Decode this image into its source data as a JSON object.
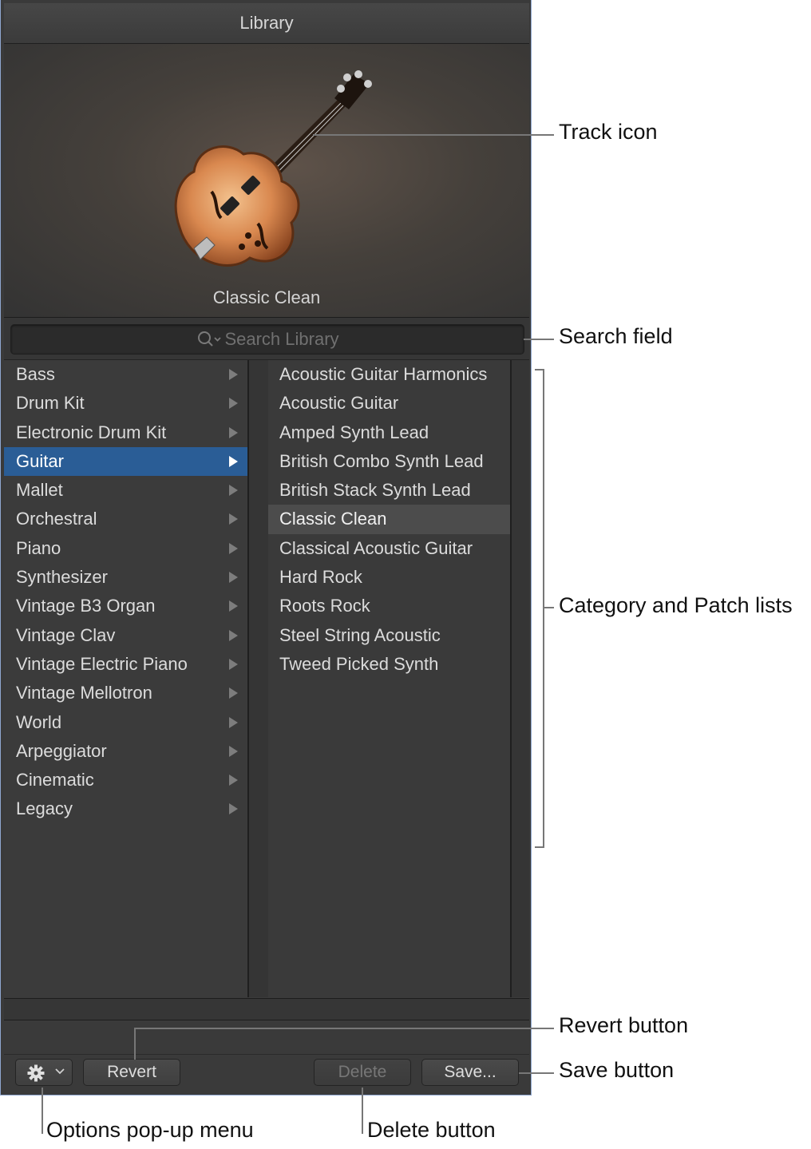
{
  "window": {
    "title": "Library"
  },
  "preview": {
    "patch_name": "Classic Clean",
    "icon": "guitar-icon"
  },
  "search": {
    "placeholder": "Search Library"
  },
  "categories": [
    {
      "label": "Bass"
    },
    {
      "label": "Drum Kit"
    },
    {
      "label": "Electronic Drum Kit"
    },
    {
      "label": "Guitar",
      "selected": true
    },
    {
      "label": "Mallet"
    },
    {
      "label": "Orchestral"
    },
    {
      "label": "Piano"
    },
    {
      "label": "Synthesizer"
    },
    {
      "label": "Vintage B3 Organ"
    },
    {
      "label": "Vintage Clav"
    },
    {
      "label": "Vintage Electric Piano"
    },
    {
      "label": "Vintage Mellotron"
    },
    {
      "label": "World"
    },
    {
      "label": "Arpeggiator"
    },
    {
      "label": "Cinematic"
    },
    {
      "label": "Legacy"
    }
  ],
  "patches": [
    {
      "label": "Acoustic Guitar Harmonics"
    },
    {
      "label": "Acoustic Guitar"
    },
    {
      "label": "Amped Synth Lead"
    },
    {
      "label": "British Combo Synth Lead"
    },
    {
      "label": "British Stack Synth Lead"
    },
    {
      "label": "Classic Clean",
      "selected": true
    },
    {
      "label": "Classical Acoustic Guitar"
    },
    {
      "label": "Hard Rock"
    },
    {
      "label": "Roots Rock"
    },
    {
      "label": "Steel String Acoustic"
    },
    {
      "label": "Tweed Picked Synth"
    }
  ],
  "buttons": {
    "options_icon": "gear-icon",
    "revert": "Revert",
    "delete": "Delete",
    "save": "Save..."
  },
  "callouts": {
    "track_icon": "Track icon",
    "search_field": "Search field",
    "category_patch": "Category and Patch lists",
    "revert_button": "Revert button",
    "save_button": "Save button",
    "options_menu": "Options pop-up menu",
    "delete_button": "Delete button"
  },
  "colors": {
    "selection_blue": "#2a5d96",
    "selection_gray": "#4c4c4c",
    "panel_bg": "#3a3a3a"
  }
}
